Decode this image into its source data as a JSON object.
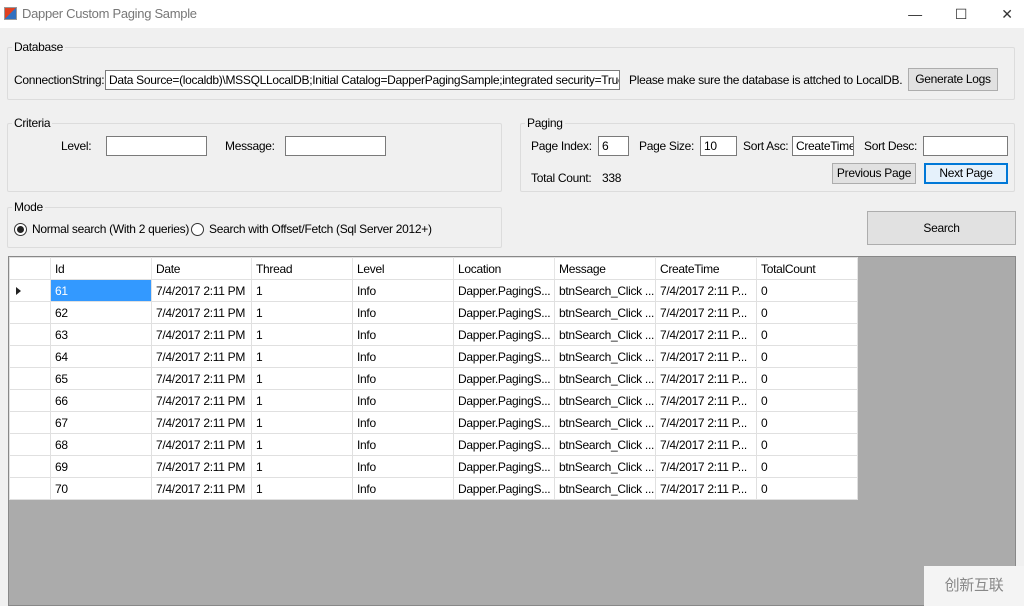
{
  "window": {
    "title": "Dapper Custom Paging Sample",
    "minimize": "—",
    "maximize": "☐",
    "close": "✕"
  },
  "database": {
    "label": "Database",
    "conn_label": "ConnectionString:",
    "conn_value": "Data Source=(localdb)\\MSSQLLocalDB;Initial Catalog=DapperPagingSample;integrated security=True;",
    "hint": "Please make sure the database is attched to LocalDB.",
    "generate_logs": "Generate Logs"
  },
  "criteria": {
    "label": "Criteria",
    "level_label": "Level:",
    "level_value": "",
    "message_label": "Message:",
    "message_value": ""
  },
  "paging": {
    "label": "Paging",
    "page_index_label": "Page Index:",
    "page_index": "6",
    "page_size_label": "Page Size:",
    "page_size": "10",
    "sort_asc_label": "Sort Asc:",
    "sort_asc": "CreateTime",
    "sort_desc_label": "Sort Desc:",
    "sort_desc": "",
    "total_count_label": "Total Count:",
    "total_count": "338",
    "previous": "Previous Page",
    "next": "Next Page"
  },
  "mode": {
    "label": "Mode",
    "options": [
      {
        "label": "Normal search (With 2 queries)",
        "selected": true
      },
      {
        "label": "Search with Offset/Fetch (Sql Server 2012+)",
        "selected": false
      }
    ]
  },
  "search_button": "Search",
  "grid": {
    "columns": [
      "Id",
      "Date",
      "Thread",
      "Level",
      "Location",
      "Message",
      "CreateTime",
      "TotalCount"
    ],
    "rows": [
      [
        "61",
        "7/4/2017 2:11 PM",
        "1",
        "Info",
        "Dapper.PagingS...",
        "btnSearch_Click ...",
        "7/4/2017 2:11 P...",
        "0"
      ],
      [
        "62",
        "7/4/2017 2:11 PM",
        "1",
        "Info",
        "Dapper.PagingS...",
        "btnSearch_Click ...",
        "7/4/2017 2:11 P...",
        "0"
      ],
      [
        "63",
        "7/4/2017 2:11 PM",
        "1",
        "Info",
        "Dapper.PagingS...",
        "btnSearch_Click ...",
        "7/4/2017 2:11 P...",
        "0"
      ],
      [
        "64",
        "7/4/2017 2:11 PM",
        "1",
        "Info",
        "Dapper.PagingS...",
        "btnSearch_Click ...",
        "7/4/2017 2:11 P...",
        "0"
      ],
      [
        "65",
        "7/4/2017 2:11 PM",
        "1",
        "Info",
        "Dapper.PagingS...",
        "btnSearch_Click ...",
        "7/4/2017 2:11 P...",
        "0"
      ],
      [
        "66",
        "7/4/2017 2:11 PM",
        "1",
        "Info",
        "Dapper.PagingS...",
        "btnSearch_Click ...",
        "7/4/2017 2:11 P...",
        "0"
      ],
      [
        "67",
        "7/4/2017 2:11 PM",
        "1",
        "Info",
        "Dapper.PagingS...",
        "btnSearch_Click ...",
        "7/4/2017 2:11 P...",
        "0"
      ],
      [
        "68",
        "7/4/2017 2:11 PM",
        "1",
        "Info",
        "Dapper.PagingS...",
        "btnSearch_Click ...",
        "7/4/2017 2:11 P...",
        "0"
      ],
      [
        "69",
        "7/4/2017 2:11 PM",
        "1",
        "Info",
        "Dapper.PagingS...",
        "btnSearch_Click ...",
        "7/4/2017 2:11 P...",
        "0"
      ],
      [
        "70",
        "7/4/2017 2:11 PM",
        "1",
        "Info",
        "Dapper.PagingS...",
        "btnSearch_Click ...",
        "7/4/2017 2:11 P...",
        "0"
      ]
    ]
  },
  "watermark": "创新互联"
}
